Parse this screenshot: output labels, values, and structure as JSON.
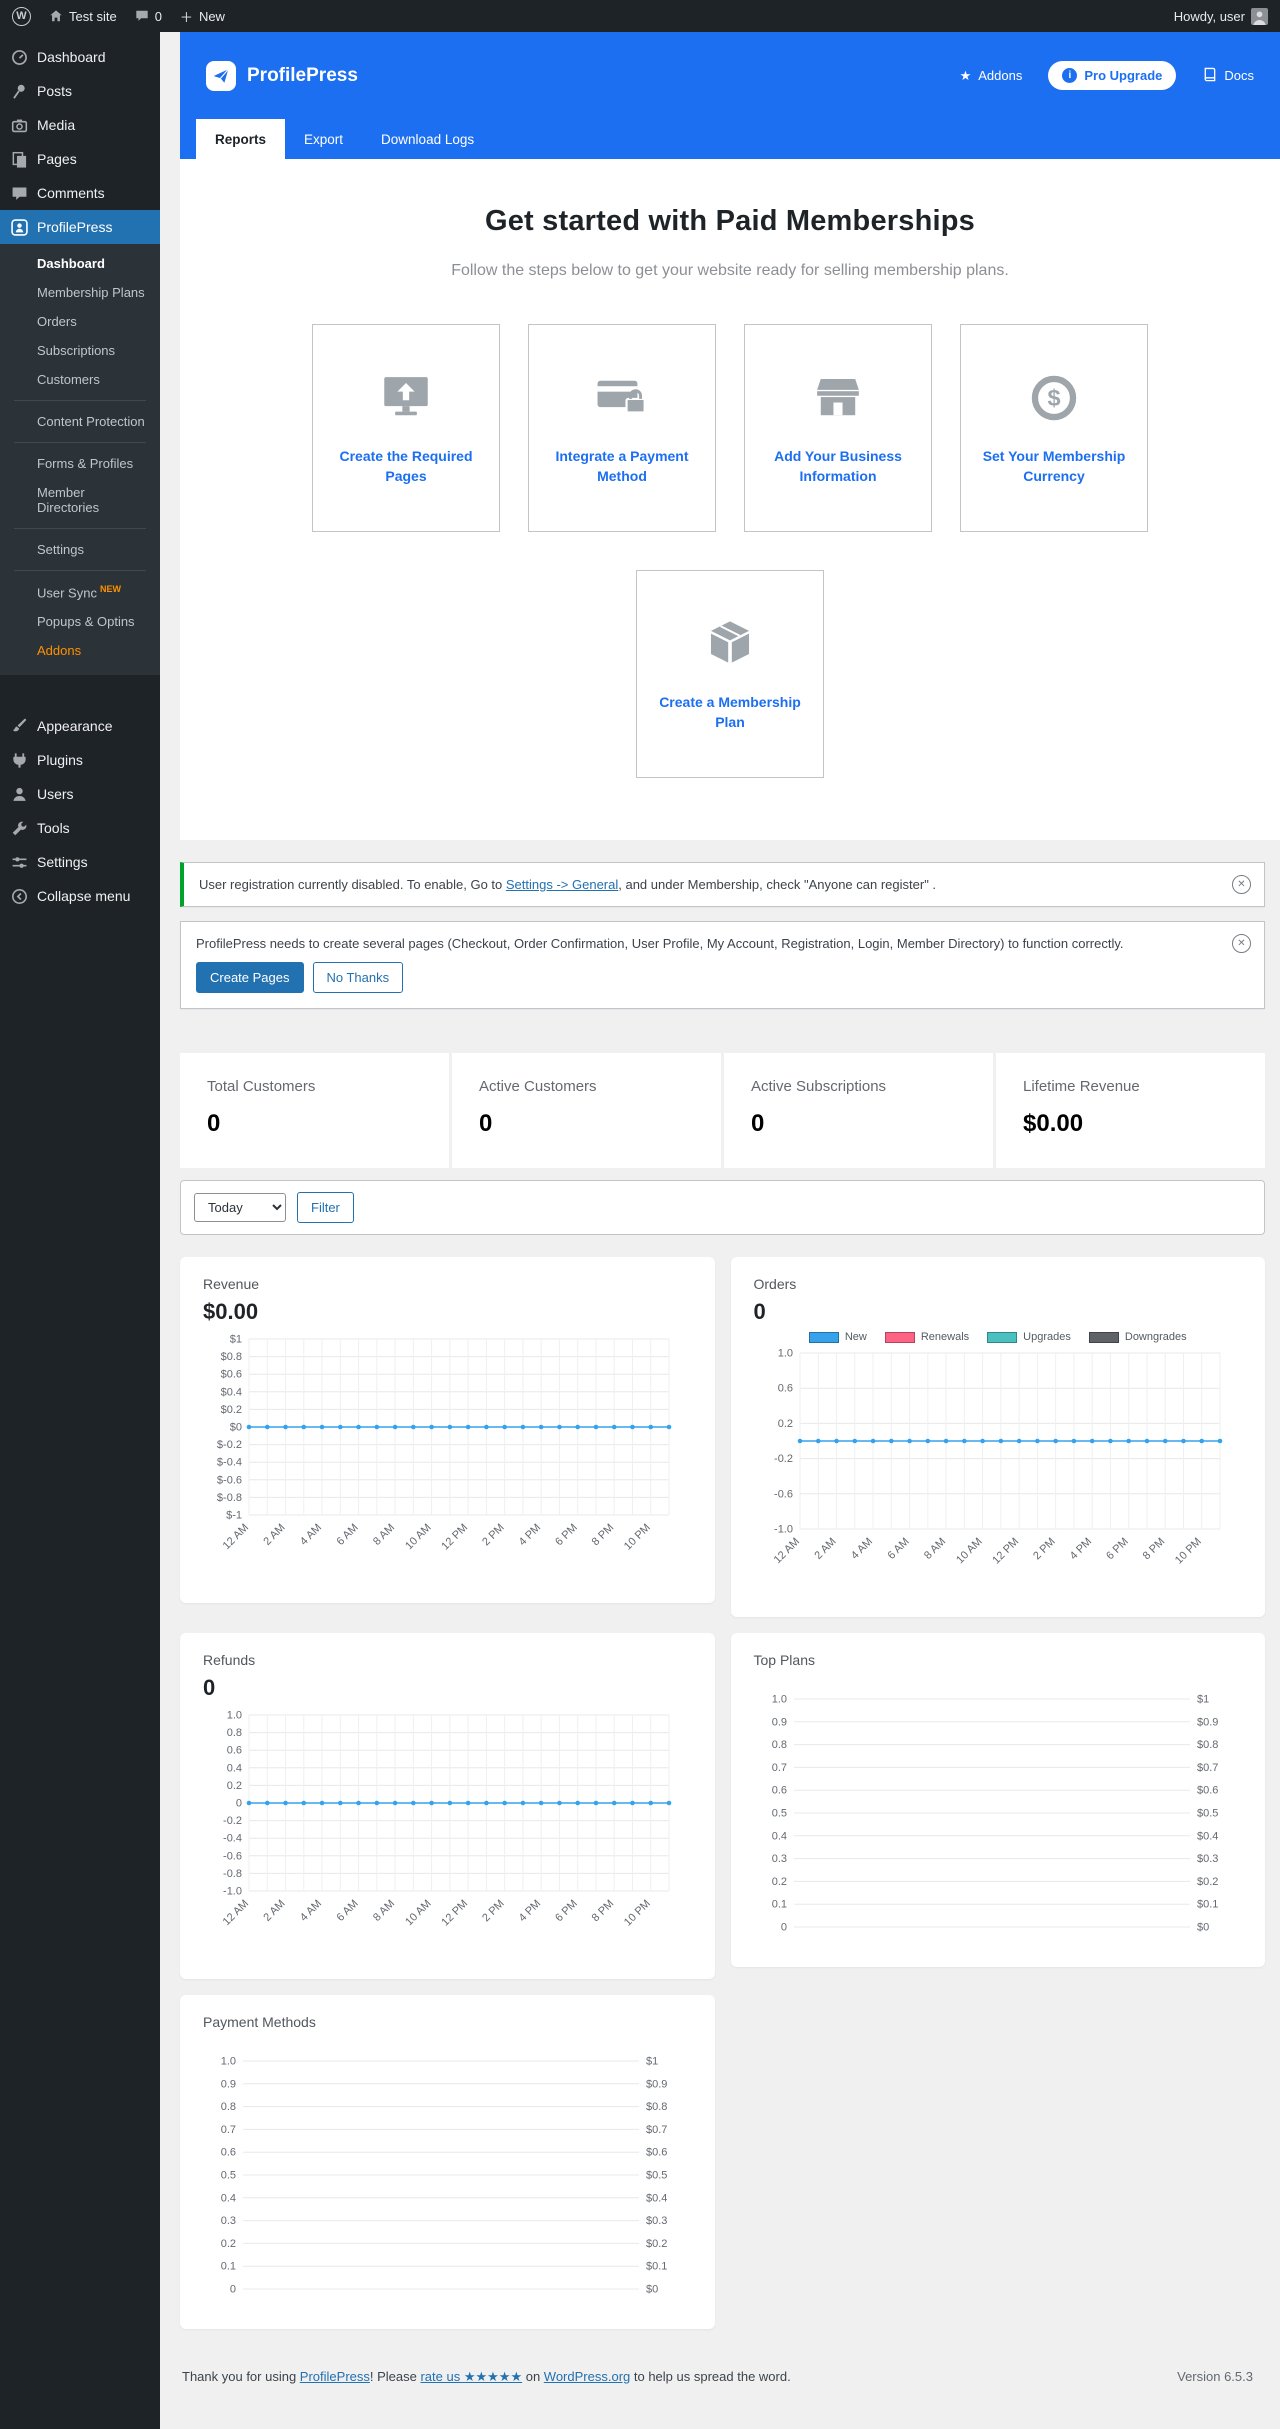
{
  "colors": {
    "admin_dark": "#1d2327",
    "submenu_dark": "#2c3338",
    "wp_active_blue": "#2271b1",
    "brand_blue": "#1d6ff2",
    "content_bg": "#f0f0f1",
    "success_green": "#00a32a",
    "chart_blue": "#36a2eb",
    "legend_pink": "#ff6384",
    "legend_teal": "#4bc0c0",
    "legend_gray": "#5f6368",
    "addon_orange": "#ff9000"
  },
  "admin_bar": {
    "site_name": "Test site",
    "comments_count": "0",
    "new_label": "New",
    "howdy": "Howdy, user"
  },
  "sidebar": {
    "top": [
      {
        "label": "Dashboard"
      },
      {
        "label": "Posts"
      },
      {
        "label": "Media"
      },
      {
        "label": "Pages"
      },
      {
        "label": "Comments"
      },
      {
        "label": "ProfilePress"
      }
    ],
    "submenu": [
      {
        "label": "Dashboard"
      },
      {
        "label": "Membership Plans"
      },
      {
        "label": "Orders"
      },
      {
        "label": "Subscriptions"
      },
      {
        "label": "Customers"
      },
      {
        "label": "Content Protection"
      },
      {
        "label": "Forms & Profiles"
      },
      {
        "label": "Member Directories"
      },
      {
        "label": "Settings"
      },
      {
        "label": "User Sync",
        "badge": "NEW"
      },
      {
        "label": "Popups & Optins"
      },
      {
        "label": "Addons"
      }
    ],
    "bottom": [
      {
        "label": "Appearance"
      },
      {
        "label": "Plugins"
      },
      {
        "label": "Users"
      },
      {
        "label": "Tools"
      },
      {
        "label": "Settings"
      },
      {
        "label": "Collapse menu"
      }
    ]
  },
  "header": {
    "brand": "ProfilePress",
    "addons": "Addons",
    "pro_upgrade": "Pro Upgrade",
    "docs": "Docs",
    "tabs": [
      {
        "label": "Reports"
      },
      {
        "label": "Export"
      },
      {
        "label": "Download Logs"
      }
    ]
  },
  "hero": {
    "title": "Get started with Paid Memberships",
    "subtitle": "Follow the steps below to get your website ready for selling membership plans.",
    "steps": [
      {
        "label": "Create the Required Pages"
      },
      {
        "label": "Integrate a Payment Method"
      },
      {
        "label": "Add Your Business Information"
      },
      {
        "label": "Set Your Membership Currency"
      },
      {
        "label": "Create a Membership Plan"
      }
    ]
  },
  "notices": {
    "registration": {
      "pre": "User registration currently disabled. To enable, Go to ",
      "link": "Settings -> General",
      "post": ", and under Membership, check \"Anyone can register\" ."
    },
    "pages": {
      "text": "ProfilePress needs to create several pages (Checkout, Order Confirmation, User Profile, My Account, Registration, Login, Member Directory) to function correctly.",
      "create_button": "Create Pages",
      "dismiss_button": "No Thanks"
    }
  },
  "stats": [
    {
      "label": "Total Customers",
      "value": "0"
    },
    {
      "label": "Active Customers",
      "value": "0"
    },
    {
      "label": "Active Subscriptions",
      "value": "0"
    },
    {
      "label": "Lifetime Revenue",
      "value": "$0.00"
    }
  ],
  "filter": {
    "period": "Today",
    "button": "Filter"
  },
  "chart_data": [
    {
      "id": "revenue",
      "type": "line",
      "title": "Revenue",
      "total": "$0.00",
      "ylim": [
        -1,
        1
      ],
      "y_ticks": [
        {
          "v": 1,
          "l": "$1"
        },
        {
          "v": 0.8,
          "l": "$0.8"
        },
        {
          "v": 0.6,
          "l": "$0.6"
        },
        {
          "v": 0.4,
          "l": "$0.4"
        },
        {
          "v": 0.2,
          "l": "$0.2"
        },
        {
          "v": 0,
          "l": "$0"
        },
        {
          "v": -0.2,
          "l": "$-0.2"
        },
        {
          "v": -0.4,
          "l": "$-0.4"
        },
        {
          "v": -0.6,
          "l": "$-0.6"
        },
        {
          "v": -0.8,
          "l": "$-0.8"
        },
        {
          "v": -1,
          "l": "$-1"
        }
      ],
      "x_labels": [
        "12 AM",
        "2 AM",
        "4 AM",
        "6 AM",
        "8 AM",
        "10 AM",
        "12 PM",
        "2 PM",
        "4 PM",
        "6 PM",
        "8 PM",
        "10 PM"
      ],
      "x_points": 24,
      "x_label_step": 2,
      "grid": true,
      "series": [
        {
          "name": "Revenue",
          "color": "#36a2eb",
          "values": [
            0,
            0,
            0,
            0,
            0,
            0,
            0,
            0,
            0,
            0,
            0,
            0,
            0,
            0,
            0,
            0,
            0,
            0,
            0,
            0,
            0,
            0,
            0,
            0
          ]
        }
      ]
    },
    {
      "id": "orders",
      "type": "line",
      "title": "Orders",
      "total": "0",
      "ylim": [
        -1,
        1
      ],
      "y_ticks": [
        {
          "v": 1,
          "l": "1.0"
        },
        {
          "v": 0.6,
          "l": "0.6"
        },
        {
          "v": 0.2,
          "l": "0.2"
        },
        {
          "v": -0.2,
          "l": "-0.2"
        },
        {
          "v": -0.6,
          "l": "-0.6"
        },
        {
          "v": -1,
          "l": "-1.0"
        }
      ],
      "x_labels": [
        "12 AM",
        "2 AM",
        "4 AM",
        "6 AM",
        "8 AM",
        "10 AM",
        "12 PM",
        "2 PM",
        "4 PM",
        "6 PM",
        "8 PM",
        "10 PM"
      ],
      "x_points": 24,
      "x_label_step": 2,
      "grid": true,
      "legend": [
        {
          "label": "New",
          "color": "#36a2eb"
        },
        {
          "label": "Renewals",
          "color": "#ff6384"
        },
        {
          "label": "Upgrades",
          "color": "#4bc0c0"
        },
        {
          "label": "Downgrades",
          "color": "#5f6368"
        }
      ],
      "series": [
        {
          "name": "New",
          "color": "#36a2eb",
          "values": [
            0,
            0,
            0,
            0,
            0,
            0,
            0,
            0,
            0,
            0,
            0,
            0,
            0,
            0,
            0,
            0,
            0,
            0,
            0,
            0,
            0,
            0,
            0,
            0
          ]
        }
      ]
    },
    {
      "id": "refunds",
      "type": "line",
      "title": "Refunds",
      "total": "0",
      "ylim": [
        -1,
        1
      ],
      "y_ticks": [
        {
          "v": 1,
          "l": "1.0"
        },
        {
          "v": 0.8,
          "l": "0.8"
        },
        {
          "v": 0.6,
          "l": "0.6"
        },
        {
          "v": 0.4,
          "l": "0.4"
        },
        {
          "v": 0.2,
          "l": "0.2"
        },
        {
          "v": 0,
          "l": "0"
        },
        {
          "v": -0.2,
          "l": "-0.2"
        },
        {
          "v": -0.4,
          "l": "-0.4"
        },
        {
          "v": -0.6,
          "l": "-0.6"
        },
        {
          "v": -0.8,
          "l": "-0.8"
        },
        {
          "v": -1,
          "l": "-1.0"
        }
      ],
      "x_labels": [
        "12 AM",
        "2 AM",
        "4 AM",
        "6 AM",
        "8 AM",
        "10 AM",
        "12 PM",
        "2 PM",
        "4 PM",
        "6 PM",
        "8 PM",
        "10 PM"
      ],
      "x_points": 24,
      "x_label_step": 2,
      "grid": true,
      "series": [
        {
          "name": "Refunds",
          "color": "#36a2eb",
          "values": [
            0,
            0,
            0,
            0,
            0,
            0,
            0,
            0,
            0,
            0,
            0,
            0,
            0,
            0,
            0,
            0,
            0,
            0,
            0,
            0,
            0,
            0,
            0,
            0
          ]
        }
      ]
    },
    {
      "id": "top_plans",
      "type": "line",
      "title": "Top Plans",
      "ylim": [
        0,
        1
      ],
      "y_ticks": [
        {
          "v": 1,
          "l": "1.0",
          "r": "$1"
        },
        {
          "v": 0.9,
          "l": "0.9",
          "r": "$0.9"
        },
        {
          "v": 0.8,
          "l": "0.8",
          "r": "$0.8"
        },
        {
          "v": 0.7,
          "l": "0.7",
          "r": "$0.7"
        },
        {
          "v": 0.6,
          "l": "0.6",
          "r": "$0.6"
        },
        {
          "v": 0.5,
          "l": "0.5",
          "r": "$0.5"
        },
        {
          "v": 0.4,
          "l": "0.4",
          "r": "$0.4"
        },
        {
          "v": 0.3,
          "l": "0.3",
          "r": "$0.3"
        },
        {
          "v": 0.2,
          "l": "0.2",
          "r": "$0.2"
        },
        {
          "v": 0.1,
          "l": "0.1",
          "r": "$0.1"
        },
        {
          "v": 0,
          "l": "0",
          "r": "$0"
        }
      ],
      "x_labels": [],
      "x_points": 0,
      "series": []
    },
    {
      "id": "payment_methods",
      "type": "line",
      "title": "Payment Methods",
      "ylim": [
        0,
        1
      ],
      "y_ticks": [
        {
          "v": 1,
          "l": "1.0",
          "r": "$1"
        },
        {
          "v": 0.9,
          "l": "0.9",
          "r": "$0.9"
        },
        {
          "v": 0.8,
          "l": "0.8",
          "r": "$0.8"
        },
        {
          "v": 0.7,
          "l": "0.7",
          "r": "$0.7"
        },
        {
          "v": 0.6,
          "l": "0.6",
          "r": "$0.6"
        },
        {
          "v": 0.5,
          "l": "0.5",
          "r": "$0.5"
        },
        {
          "v": 0.4,
          "l": "0.4",
          "r": "$0.4"
        },
        {
          "v": 0.3,
          "l": "0.3",
          "r": "$0.3"
        },
        {
          "v": 0.2,
          "l": "0.2",
          "r": "$0.2"
        },
        {
          "v": 0.1,
          "l": "0.1",
          "r": "$0.1"
        },
        {
          "v": 0,
          "l": "0",
          "r": "$0"
        }
      ],
      "x_labels": [],
      "x_points": 0,
      "series": []
    }
  ],
  "footer": {
    "thanks_pre": "Thank you for using ",
    "brand_link": "ProfilePress",
    "mid1": "! Please ",
    "rate_link": "rate us ★★★★★",
    "mid2": " on ",
    "wp_link": "WordPress.org",
    "post": " to help us spread the word.",
    "version": "Version 6.5.3"
  }
}
